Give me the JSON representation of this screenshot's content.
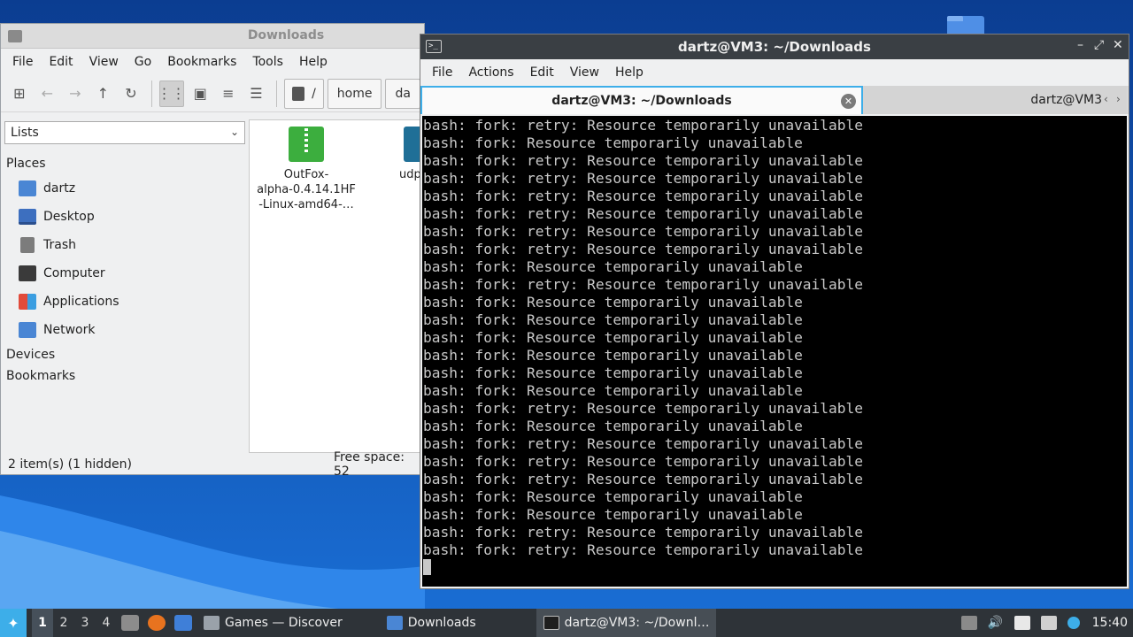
{
  "colors": {
    "accent": "#3daee9",
    "terminal_bg": "#000000",
    "terminal_fg": "#c8c8c8",
    "taskbar_bg": "#2e3338"
  },
  "file_manager": {
    "title": "Downloads",
    "menu": [
      "File",
      "Edit",
      "View",
      "Go",
      "Bookmarks",
      "Tools",
      "Help"
    ],
    "path": [
      "/",
      "home",
      "da"
    ],
    "side_pane_mode": "Lists",
    "sections": {
      "places": "Places",
      "devices": "Devices",
      "bookmarks": "Bookmarks"
    },
    "places": [
      {
        "label": "dartz",
        "icon": "home-folder-icon"
      },
      {
        "label": "Desktop",
        "icon": "desktop-icon"
      },
      {
        "label": "Trash",
        "icon": "trash-icon"
      },
      {
        "label": "Computer",
        "icon": "computer-icon"
      },
      {
        "label": "Applications",
        "icon": "applications-icon"
      },
      {
        "label": "Network",
        "icon": "network-icon"
      }
    ],
    "files": [
      {
        "name_line1": "OutFox-",
        "name_line2": "alpha-0.4.14.1HF",
        "name_line3": "-Linux-amd64-…",
        "icon": "zip-archive-icon"
      },
      {
        "name_line1": "udp",
        "icon": "deb-package-icon"
      }
    ],
    "status_items": "2 item(s) (1 hidden)",
    "status_free": "Free space: 52"
  },
  "terminal": {
    "title": "dartz@VM3: ~/Downloads",
    "menu": [
      "File",
      "Actions",
      "Edit",
      "View",
      "Help"
    ],
    "tabs": [
      "dartz@VM3: ~/Downloads",
      "dartz@VM3"
    ],
    "lines": [
      "bash: fork: retry: Resource temporarily unavailable",
      "bash: fork: Resource temporarily unavailable",
      "bash: fork: retry: Resource temporarily unavailable",
      "bash: fork: retry: Resource temporarily unavailable",
      "bash: fork: retry: Resource temporarily unavailable",
      "bash: fork: retry: Resource temporarily unavailable",
      "bash: fork: retry: Resource temporarily unavailable",
      "bash: fork: retry: Resource temporarily unavailable",
      "bash: fork: Resource temporarily unavailable",
      "bash: fork: retry: Resource temporarily unavailable",
      "bash: fork: Resource temporarily unavailable",
      "bash: fork: Resource temporarily unavailable",
      "bash: fork: Resource temporarily unavailable",
      "bash: fork: Resource temporarily unavailable",
      "bash: fork: Resource temporarily unavailable",
      "bash: fork: Resource temporarily unavailable",
      "bash: fork: retry: Resource temporarily unavailable",
      "bash: fork: Resource temporarily unavailable",
      "bash: fork: retry: Resource temporarily unavailable",
      "bash: fork: retry: Resource temporarily unavailable",
      "bash: fork: retry: Resource temporarily unavailable",
      "bash: fork: Resource temporarily unavailable",
      "bash: fork: Resource temporarily unavailable",
      "bash: fork: retry: Resource temporarily unavailable",
      "bash: fork: retry: Resource temporarily unavailable"
    ]
  },
  "taskbar": {
    "workspaces": [
      "1",
      "2",
      "3",
      "4"
    ],
    "tasks": [
      {
        "label": "Games — Discover",
        "icon": "discover-icon"
      },
      {
        "label": "Downloads",
        "icon": "folder-icon"
      },
      {
        "label": "dartz@VM3: ~/Downl…",
        "icon": "terminal-icon"
      }
    ],
    "clock": "15:40"
  }
}
